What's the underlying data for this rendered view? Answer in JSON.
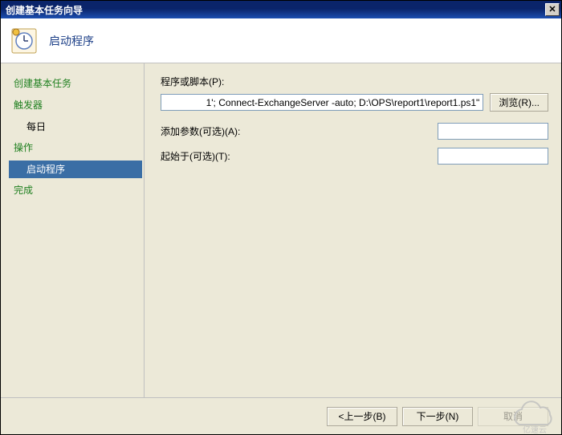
{
  "window": {
    "title": "创建基本任务向导"
  },
  "header": {
    "title": "启动程序"
  },
  "sidebar": {
    "heading1": "创建基本任务",
    "heading2": "触发器",
    "item_trigger_daily": "每日",
    "heading3": "操作",
    "item_action_start": "启动程序",
    "heading4": "完成"
  },
  "main": {
    "script_label": "程序或脚本(P):",
    "script_value": "1'; Connect-ExchangeServer -auto; D:\\OPS\\report1\\report1.ps1\"",
    "browse_label": "浏览(R)...",
    "args_label": "添加参数(可选)(A):",
    "args_value": "",
    "startin_label": "起始于(可选)(T):",
    "startin_value": ""
  },
  "buttons": {
    "back": "<上一步(B)",
    "next": "下一步(N)",
    "cancel": "取消"
  },
  "watermark": "亿速云"
}
